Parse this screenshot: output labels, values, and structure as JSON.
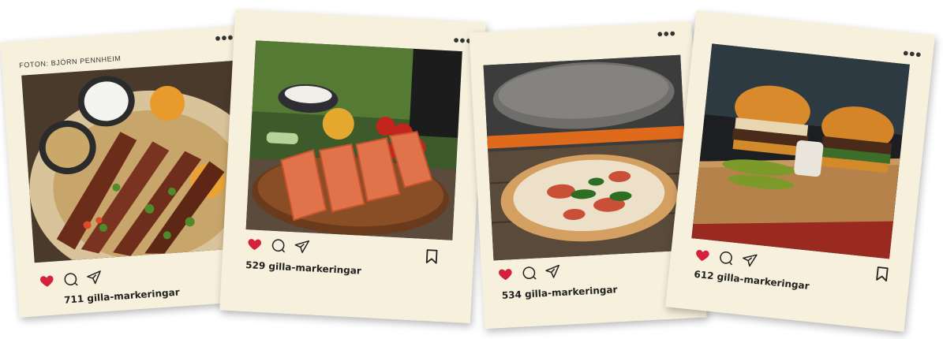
{
  "credit": "FOTON: BJÖRN PENNHEIM",
  "menu_glyph": "•••",
  "posts": [
    {
      "id": "kebab",
      "likes_text": "711 gilla-markeringar",
      "liked": true,
      "bookmark_visible": false
    },
    {
      "id": "salmon",
      "likes_text": "529 gilla-markeringar",
      "liked": true,
      "bookmark_visible": true
    },
    {
      "id": "pizza",
      "likes_text": "534 gilla-markeringar",
      "liked": true,
      "bookmark_visible": false
    },
    {
      "id": "burger",
      "likes_text": "612 gilla-markeringar",
      "liked": true,
      "bookmark_visible": true
    }
  ],
  "icons": {
    "like": "heart-icon",
    "comment": "comment-icon",
    "share": "paper-plane-icon",
    "save": "bookmark-icon",
    "menu": "more-dots-icon"
  },
  "colors": {
    "card": "#f7f0dc",
    "heart": "#d4213d",
    "ink": "#222222"
  }
}
